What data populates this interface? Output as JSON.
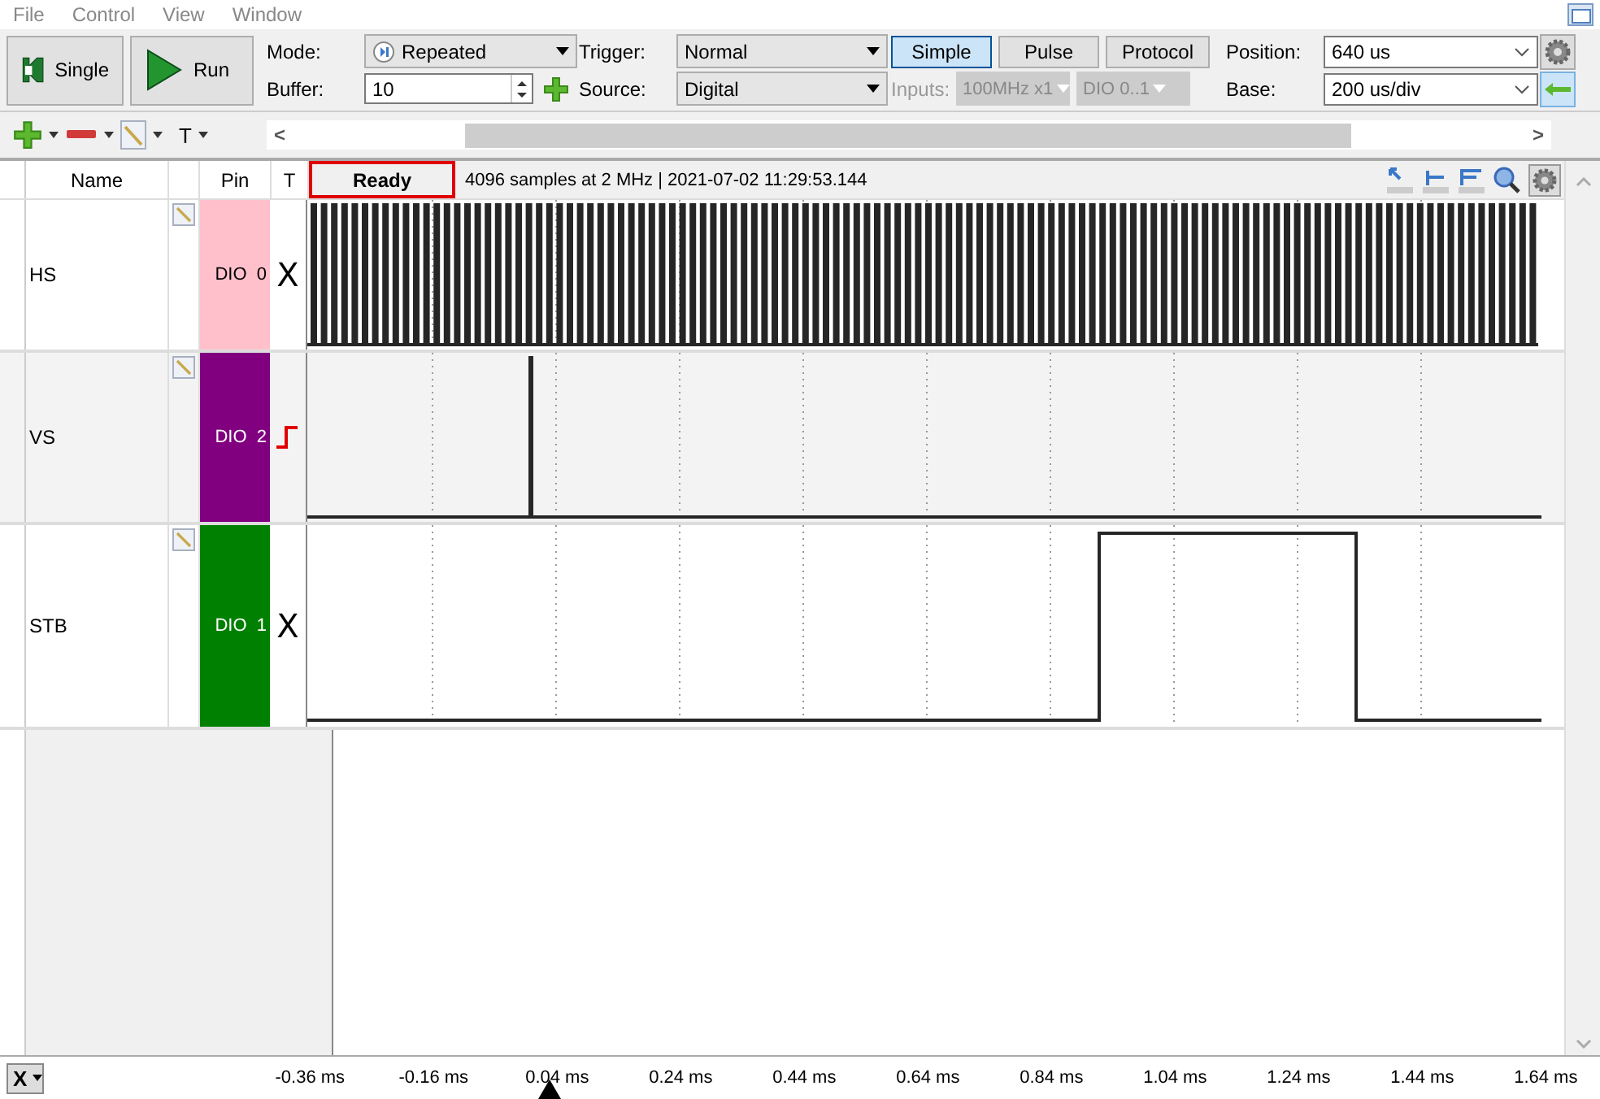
{
  "menu": [
    "File",
    "Control",
    "View",
    "Window"
  ],
  "toolbar": {
    "single": "Single",
    "run": "Run",
    "mode_label": "Mode:",
    "mode": "Repeated",
    "buffer_label": "Buffer:",
    "buffer": "10",
    "trigger_label": "Trigger:",
    "trigger": "Normal",
    "source_label": "Source:",
    "source": "Digital",
    "trigger_tabs": [
      {
        "label": "Simple",
        "selected": true
      },
      {
        "label": "Pulse",
        "selected": false
      },
      {
        "label": "Protocol",
        "selected": false
      }
    ],
    "inputs_label": "Inputs:",
    "inputs": [
      {
        "value": "100MHz x1",
        "disabled": true
      },
      {
        "value": "DIO 0..1",
        "disabled": true
      }
    ],
    "position_label": "Position:",
    "position": "640 us",
    "base_label": "Base:",
    "base": "200 us/div"
  },
  "toolbar2": {
    "text_tool": "T",
    "scroll_left": "<",
    "scroll_right": ">"
  },
  "table": {
    "columns": [
      "Name",
      "Pin",
      "T"
    ]
  },
  "status": {
    "state": "Ready",
    "info": "4096 samples at 2 MHz | 2021-07-02 11:29:53.144"
  },
  "channels": [
    {
      "name": "HS",
      "pin": "DIO  0",
      "color": "#ffc0cb",
      "trigger": {
        "kind": "dont_care",
        "symbol": "X"
      },
      "kind": "clock"
    },
    {
      "name": "VS",
      "pin": "DIO  2",
      "color": "#800080",
      "trigger": {
        "kind": "rising"
      },
      "kind": "spike"
    },
    {
      "name": "STB",
      "pin": "DIO  1",
      "color": "#008000",
      "trigger": {
        "kind": "dont_care",
        "symbol": "X"
      },
      "kind": "pulse"
    }
  ],
  "axis": {
    "selector": "X",
    "ticks": [
      "-0.36 ms",
      "-0.16 ms",
      "0.04 ms",
      "0.24 ms",
      "0.44 ms",
      "0.64 ms",
      "0.84 ms",
      "1.04 ms",
      "1.24 ms",
      "1.44 ms",
      "1.64 ms"
    ]
  }
}
